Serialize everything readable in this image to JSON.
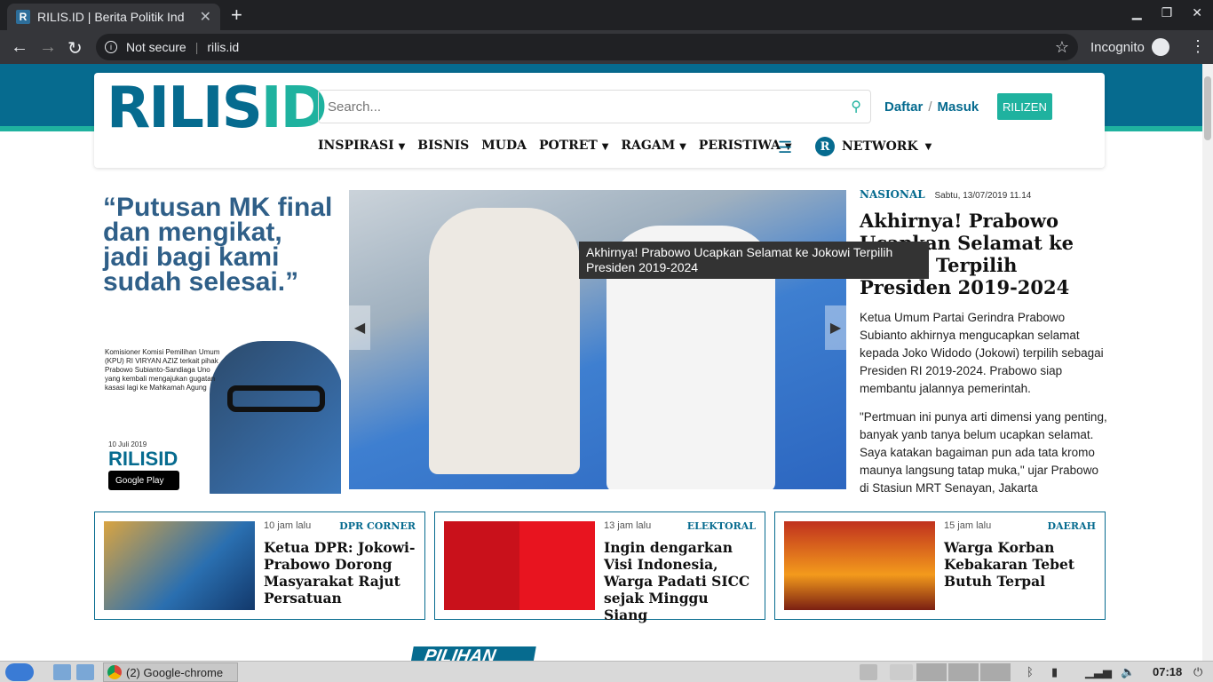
{
  "browser": {
    "tab_title": "RILIS.ID | Berita Politik Ind",
    "tab_favicon": "R",
    "close_tab": "✕",
    "new_tab": "+",
    "security": "Not secure",
    "url": "rilis.id",
    "incognito": "Incognito"
  },
  "header": {
    "logo_main": "RILIS",
    "logo_id": "ID",
    "search_placeholder": "Search...",
    "daftar": "Daftar",
    "slash": "/",
    "masuk": "Masuk",
    "rilizen": "RILIZEN",
    "menu": [
      "INSPIRASI",
      "BISNIS",
      "MUDA",
      "POTRET",
      "RAGAM",
      "PERISTIWA"
    ],
    "network": "NETWORK",
    "network_badge": "R"
  },
  "ad": {
    "quote": "“Putusan MK final dan mengikat, jadi bagi kami sudah selesai.”",
    "caption": "Komisioner Komisi Pemilihan Umum (KPU) RI VIRYAN AZIZ terkait pihak Prabowo Subianto-Sandiaga Uno yang kembali mengajukan gugatan kasasi lagi ke Mahkamah Agung",
    "date": "10 Juli 2019",
    "logo": "RILISID",
    "store": "Google Play"
  },
  "hero": {
    "tooltip": "Akhirnya! Prabowo Ucapkan Selamat ke Jokowi Terpilih Presiden 2019-2024"
  },
  "headline": {
    "category": "NASIONAL",
    "date": "Sabtu, 13/07/2019 11.14",
    "title": "Akhirnya! Prabowo Ucapkan Selamat ke Jokowi Terpilih Presiden 2019-2024",
    "p1": "Ketua Umum Partai Gerindra Prabowo Subianto akhirnya mengucapkan selamat kepada Joko Widodo (Jokowi) terpilih sebagai Presiden RI 2019-2024. Prabowo siap membantu jalannya pemerintah.",
    "p2": "\"Pertmuan ini punya arti dimensi yang penting, banyak yanb tanya belum ucapkan selamat. Saya katakan bagaiman pun ada tata kromo maunya langsung tatap muka,\" ujar Prabowo di Stasiun MRT Senayan, Jakarta"
  },
  "cards": [
    {
      "time": "10 jam lalu",
      "category": "DPR CORNER",
      "title": "Ketua DPR: Jokowi-Prabowo Dorong Masyarakat Rajut Persatuan"
    },
    {
      "time": "13 jam lalu",
      "category": "ELEKTORAL",
      "title": "Ingin dengarkan Visi Indonesia, Warga Padati SICC sejak Minggu Siang"
    },
    {
      "time": "15 jam lalu",
      "category": "DAERAH",
      "title": "Warga Korban Kebakaran Tebet Butuh Terpal"
    }
  ],
  "pilihan": "PILIHAN",
  "taskbar": {
    "chrome_label": "(2) Google-chrome",
    "clock": "07:18"
  }
}
